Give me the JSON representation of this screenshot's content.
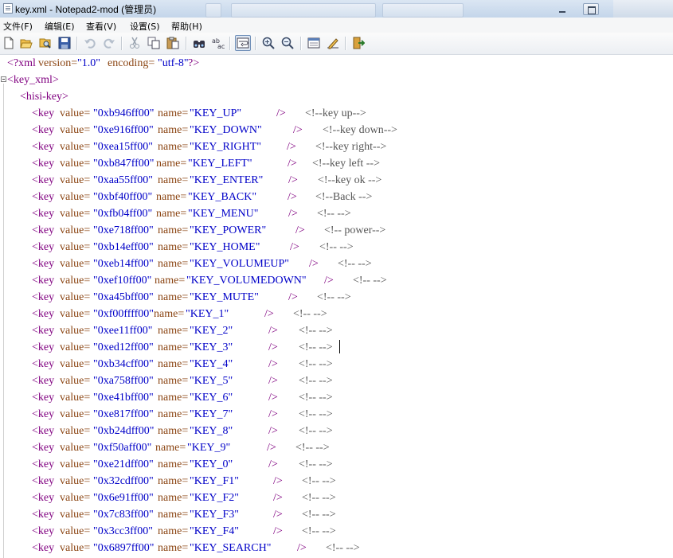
{
  "window": {
    "title": "key.xml - Notepad2-mod (管理员)"
  },
  "menubar": {
    "items": [
      "文件(F)",
      "编辑(E)",
      "查看(V)",
      "设置(S)",
      "帮助(H)"
    ]
  },
  "toolbar": {
    "icons": [
      "new-file-icon",
      "open-folder-icon",
      "browse-icon",
      "save-icon",
      "undo-icon",
      "redo-icon",
      "cut-icon",
      "copy-icon",
      "paste-icon",
      "find-icon",
      "replace-icon",
      "word-wrap-icon",
      "zoom-in-icon",
      "zoom-out-icon",
      "settings-icon",
      "edit-scheme-icon",
      "exit-icon"
    ]
  },
  "editor": {
    "xml_decl": {
      "open": "<?xml",
      "version_attr": "version=",
      "version_val": "\"1.0\"",
      "encoding_attr": "encoding=",
      "encoding_val": "\"utf-8\"",
      "close": "?>"
    },
    "root_open": "<key_xml>",
    "group_open": "<hisi-key>",
    "key_tag": "<key",
    "value_attr": "value=",
    "name_attr": "name=",
    "tag_close": "/>",
    "keys": [
      {
        "value": "\"0xb946ff00\"",
        "name": "\"KEY_UP\"",
        "comment": "<!--key up-->"
      },
      {
        "value": "\"0xe916ff00\"",
        "name": "\"KEY_DOWN\"",
        "comment": "<!--key down-->"
      },
      {
        "value": "\"0xea15ff00\"",
        "name": "\"KEY_RIGHT\"",
        "comment": "<!--key right-->"
      },
      {
        "value": "\"0xb847ff00\"",
        "name": "\"KEY_LEFT\"",
        "comment": "<!--key left -->"
      },
      {
        "value": "\"0xaa55ff00\"",
        "name": "\"KEY_ENTER\"",
        "comment": "<!--key ok -->"
      },
      {
        "value": "\"0xbf40ff00\"",
        "name": "\"KEY_BACK\"",
        "comment": "<!--Back -->"
      },
      {
        "value": "\"0xfb04ff00\"",
        "name": "\"KEY_MENU\"",
        "comment": "<!-- -->"
      },
      {
        "value": "\"0xe718ff00\"",
        "name": "\"KEY_POWER\"",
        "comment": "<!-- power-->"
      },
      {
        "value": "\"0xb14eff00\"",
        "name": "\"KEY_HOME\"",
        "comment": "<!-- -->"
      },
      {
        "value": "\"0xeb14ff00\"",
        "name": "\"KEY_VOLUMEUP\"",
        "comment": "<!-- -->"
      },
      {
        "value": "\"0xef10ff00\"",
        "name": "\"KEY_VOLUMEDOWN\"",
        "comment": "<!-- -->"
      },
      {
        "value": "\"0xa45bff00\"",
        "name": "\"KEY_MUTE\"",
        "comment": "<!-- -->"
      },
      {
        "value": "\"0xf00ffff00\"",
        "name": "\"KEY_1\"",
        "comment": "<!-- -->"
      },
      {
        "value": "\"0xee11ff00\"",
        "name": "\"KEY_2\"",
        "comment": "<!-- -->"
      },
      {
        "value": "\"0xed12ff00\"",
        "name": "\"KEY_3\"",
        "comment": "<!-- -->"
      },
      {
        "value": "\"0xb34cff00\"",
        "name": "\"KEY_4\"",
        "comment": "<!-- -->"
      },
      {
        "value": "\"0xa758ff00\"",
        "name": "\"KEY_5\"",
        "comment": "<!-- -->"
      },
      {
        "value": "\"0xe41bff00\"",
        "name": "\"KEY_6\"",
        "comment": "<!-- -->"
      },
      {
        "value": "\"0xe817ff00\"",
        "name": "\"KEY_7\"",
        "comment": "<!-- -->"
      },
      {
        "value": "\"0xb24dff00\"",
        "name": "\"KEY_8\"",
        "comment": "<!-- -->"
      },
      {
        "value": "\"0xf50aff00\"",
        "name": "\"KEY_9\"",
        "comment": "<!-- -->"
      },
      {
        "value": "\"0xe21dff00\"",
        "name": "\"KEY_0\"",
        "comment": "<!-- -->"
      },
      {
        "value": "\"0x32cdff00\"",
        "name": "\"KEY_F1\"",
        "comment": "<!-- -->"
      },
      {
        "value": "\"0x6e91ff00\"",
        "name": "\"KEY_F2\"",
        "comment": "<!-- -->"
      },
      {
        "value": "\"0x7c83ff00\"",
        "name": "\"KEY_F3\"",
        "comment": "<!-- -->"
      },
      {
        "value": "\"0x3cc3ff00\"",
        "name": "\"KEY_F4\"",
        "comment": "<!-- -->"
      },
      {
        "value": "\"0x6897ff00\"",
        "name": "\"KEY_SEARCH\"",
        "comment": "<!-- -->"
      }
    ]
  },
  "colors": {
    "tag": "#800080",
    "attribute": "#8b4513",
    "value": "#0000c8",
    "comment": "#555555"
  }
}
